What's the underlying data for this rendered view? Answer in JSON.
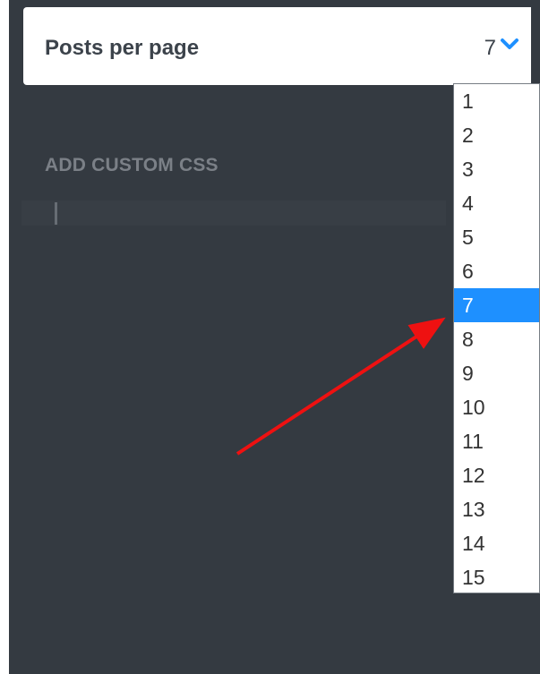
{
  "setting": {
    "label": "Posts per page",
    "value": "7",
    "icon": "chevron-down-icon",
    "accent_color": "#1e90ff"
  },
  "section": {
    "title": "ADD CUSTOM CSS"
  },
  "dropdown": {
    "options": [
      "1",
      "2",
      "3",
      "4",
      "5",
      "6",
      "7",
      "8",
      "9",
      "10",
      "11",
      "12",
      "13",
      "14",
      "15"
    ],
    "selected": "7",
    "selected_color": "#1e90ff"
  },
  "annotation": {
    "arrow_color": "#ee1111",
    "points_to": "7"
  }
}
